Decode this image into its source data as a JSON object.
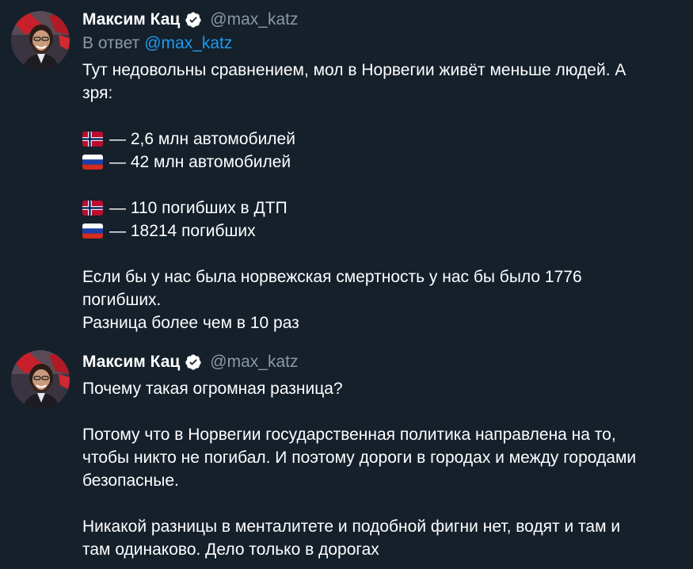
{
  "colors": {
    "background": "#15202b",
    "text": "#ffffff",
    "muted": "#8b98a5",
    "link": "#1d9bf0",
    "verified": "#ffffff"
  },
  "tweets": [
    {
      "author": {
        "name": "Максим Кац",
        "handle": "@max_katz",
        "verified": true
      },
      "reply_to": {
        "prefix": "В ответ",
        "mention": "@max_katz"
      },
      "lines": [
        "Тут недовольны сравнением, мол в Норвегии живёт меньше людей. А",
        "зря:",
        "",
        "— 2,6 млн автомобилей",
        "— 42 млн автомобилей",
        "",
        "— 110 погибших в ДТП",
        "— 18214 погибших",
        "",
        "Если бы у нас была норвежская смертность у нас бы было 1776",
        "погибших.",
        "Разница более чем в 10 раз"
      ],
      "flags": [
        "norway-flag-icon",
        "russia-flag-icon",
        "norway-flag-icon",
        "russia-flag-icon"
      ]
    },
    {
      "author": {
        "name": "Максим Кац",
        "handle": "@max_katz",
        "verified": true
      },
      "lines": [
        "Почему такая огромная разница?",
        "",
        "Потому что в Норвегии государственная политика направлена на то,",
        "чтобы никто не погибал. И поэтому дороги в городах и между городами",
        "безопасные.",
        "",
        "Никакой разницы в менталитете и подобной фигни нет, водят и там и",
        "там одинаково. Дело только в дорогах"
      ]
    }
  ]
}
